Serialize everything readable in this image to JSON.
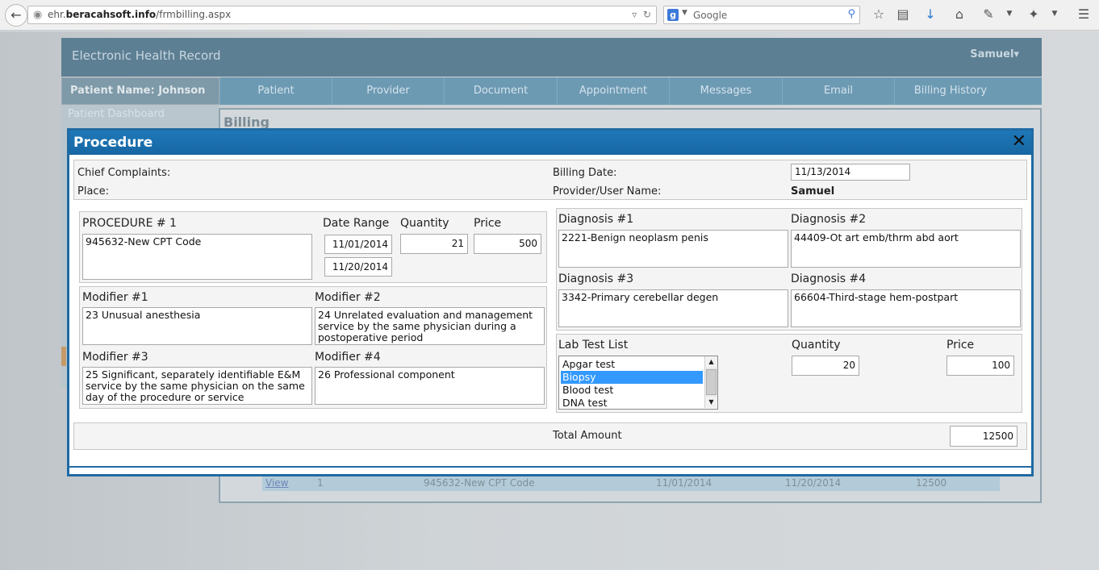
{
  "browser": {
    "url_prefix": "ehr.",
    "url_domain": "beracahsoft.info",
    "url_path": "/frmbilling.aspx",
    "search_placeholder": "Google"
  },
  "app": {
    "title": "Electronic Health Record",
    "user": "Samuel"
  },
  "nav": {
    "patient_label": "Patient Name:",
    "patient_name": "Johnson",
    "tabs": [
      "Patient",
      "Provider",
      "Document",
      "Appointment",
      "Messages",
      "Email",
      "Billing History"
    ]
  },
  "sidebar": {
    "item": "Patient Dashboard"
  },
  "billing": {
    "title": "Billing",
    "row": {
      "link": "View",
      "num": "1",
      "code": "945632-New CPT Code",
      "from": "11/01/2014",
      "to": "11/20/2014",
      "amount": "12500"
    }
  },
  "modal": {
    "title": "Procedure",
    "close": "✕",
    "chief_complaints_label": "Chief Complaints:",
    "place_label": "Place:",
    "billing_date_label": "Billing Date:",
    "billing_date": "11/13/2014",
    "provider_label": "Provider/User Name:",
    "provider": "Samuel",
    "procedure": {
      "label": "PROCEDURE # 1",
      "value": "945632-New CPT Code",
      "date_range_label": "Date Range",
      "date_from": "11/01/2014",
      "date_to": "11/20/2014",
      "quantity_label": "Quantity",
      "quantity": "21",
      "price_label": "Price",
      "price": "500"
    },
    "modifiers": {
      "m1_label": "Modifier #1",
      "m1": "23  Unusual anesthesia",
      "m2_label": "Modifier #2",
      "m2": "24  Unrelated evaluation and management service by the same physician during a postoperative period",
      "m3_label": "Modifier #3",
      "m3": "25  Significant, separately identifiable E&M service by the same physician on the same day of the procedure or  service",
      "m4_label": "Modifier #4",
      "m4": "26  Professional component"
    },
    "diagnosis": {
      "d1_label": "Diagnosis #1",
      "d1": "2221-Benign neoplasm penis",
      "d2_label": "Diagnosis #2",
      "d2": "44409-Ot art emb/thrm abd aort",
      "d3_label": "Diagnosis #3",
      "d3": "3342-Primary cerebellar degen",
      "d4_label": "Diagnosis #4",
      "d4": "66604-Third-stage hem-postpart"
    },
    "lab": {
      "label": "Lab Test List",
      "items": [
        "Apgar test",
        "Biopsy",
        "Blood test",
        "DNA test"
      ],
      "selected": "Biopsy",
      "quantity_label": "Quantity",
      "quantity": "20",
      "price_label": "Price",
      "price": "100"
    },
    "total_label": "Total Amount",
    "total": "12500"
  }
}
